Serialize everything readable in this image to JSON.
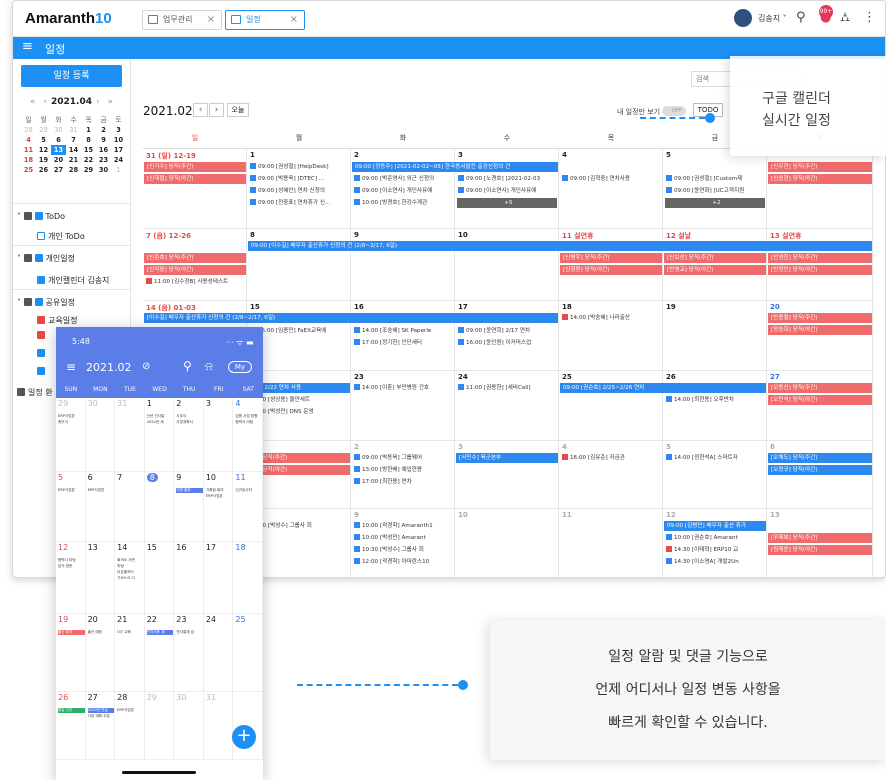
{
  "app": {
    "logo_main": "Amaranth",
    "logo_num": "10"
  },
  "tabs": [
    {
      "label": "업무관리"
    },
    {
      "label": "일정"
    }
  ],
  "user": {
    "name": "김송지"
  },
  "header": {
    "notif_count": "99+",
    "menu_title": "일정"
  },
  "sidebar": {
    "register": "일정 등록",
    "month": "2021.04",
    "weekdays": [
      "일",
      "월",
      "화",
      "수",
      "목",
      "금",
      "토"
    ],
    "weeks": [
      [
        "28",
        "29",
        "30",
        "31",
        "1",
        "2",
        "3"
      ],
      [
        "4",
        "5",
        "6",
        "7",
        "8",
        "9",
        "10"
      ],
      [
        "11",
        "12",
        "13",
        "14",
        "15",
        "16",
        "17"
      ],
      [
        "18",
        "19",
        "20",
        "21",
        "22",
        "23",
        "24"
      ],
      [
        "25",
        "26",
        "27",
        "28",
        "29",
        "30",
        "1"
      ]
    ],
    "todo_group": "ToDo",
    "todo_item": "개인 ToDo",
    "personal_group": "개인일정",
    "personal_item": "개인캘린더 김송지",
    "shared_group": "공유일정",
    "shared_item": "교육일정",
    "bottom": "일정 환"
  },
  "main": {
    "search": "검색",
    "title": "2021.02",
    "today": "오늘",
    "only_mine": "내 일정만 보기",
    "toggle": "OFF",
    "todo": "TODO",
    "weekdays": [
      "일",
      "월",
      "화",
      "수",
      "목",
      "금",
      "토"
    ]
  },
  "calendar": {
    "w1": [
      "31 (일) 12-19",
      "1",
      "2",
      "3",
      "4",
      "5",
      ""
    ],
    "w2": [
      "7 (음) 12-26",
      "8",
      "9",
      "10",
      "11 설연휴",
      "12 설날",
      "13 설연휴"
    ],
    "w3": [
      "14 (음) 01-03",
      "15",
      "16",
      "17",
      "18",
      "19",
      "20"
    ],
    "w4": [
      "",
      "",
      "23",
      "24",
      "25",
      "26",
      "27"
    ],
    "w5": [
      "",
      "",
      "2",
      "3",
      "4",
      "5",
      "6"
    ],
    "w6": [
      "",
      "",
      "9",
      "10",
      "11",
      "12",
      "13"
    ],
    "ev": {
      "a1": "[신가수] 당직(주간)",
      "a2": "[신대협] 당직(야간)",
      "a3": "09:00 [정동주] [2021-02-02~05] 한국동서발전 출장신청의 건",
      "b1": "09:00 [권성철] [HelpDesk]",
      "b2": "09:00 [박용욱] [DTEC] ...",
      "b3": "09:00 [성혜인] 연차 신청의",
      "b4": "09:00 [전중표] 연차휴가 신...",
      "c1": "09:00 [박준영사] 외근 신청의",
      "c2": "09:00 [이소연사] 개인사유에",
      "c3": "10:00 [방경호] 한강수계관",
      "d1": "09:00 [노경호] [2021-02-03",
      "d2": "09:00 [이소연사] 개인사유에",
      "d3": "+5",
      "e1": "09:00 [김혁중] 연차사용",
      "f1": "09:00 [권성철] [Custom제",
      "f2": "09:00 [윤연화] [UC고객지원",
      "f3": "+2",
      "g1": "[신우현] 당직(주간)",
      "g2": "[신승현] 당직(야간)",
      "h1": "[신준호] 당직(주간)",
      "h2": "[신미웅] 당직(야간)",
      "h3": "11:00 [김수정B] 사용성테스트",
      "h4": "09:00 [이수길] 배우자 출산휴가 신청의 건 (2/8~2/17, 6일)",
      "i1": "[신병우] 당직(주간)",
      "i2": "[신형환] 당직(야간)",
      "i3": "[신보성] 당직(주간)",
      "i4": "[안영교] 당직(야간)",
      "i5": "[안영진] 당직(주간)",
      "i6": "[안정인] 당직(야간)",
      "j1": "[이수길] 배우자 출산휴가 신청의 건 (2/8~2/17, 6일)",
      "j2": "14:00 [박숭혜] 나라출산",
      "j3": "15:00 [임종민] FaEX교육에",
      "j4": "14:00 [조숭혜] SK Paperle",
      "j5": "17:00 [정기헌] 인단세터",
      "j6": "09:00 [윤연희] 2/17 연차",
      "j7": "16:00 [윤인원] 이커머스업",
      "j8": "[안종철] 당직(주간)",
      "j9": "[양승희] 당직(야간)",
      "k1": "[양]] 2/22 연차 사용",
      "k2": "14:00 [이훈] 부민병원 건호",
      "k3": "11:00 [권용한] [세비Cell]",
      "k4": "09:00 [권순호] 2/25~2/26 연차",
      "k5": "14:00 [최현용] 오후반차",
      "k6": "[오동신] 당직(주간)",
      "k7": "[오민석] 당직(야간)",
      "k8": "09:00 [성상용] 울만세트",
      "k9": "09:00 [박성민] DNS 운영",
      "l1": "[인] 당직(주간)",
      "l2": "[인] 당직(야간)",
      "l3": "09:00 [박동욱] 그룹웨어",
      "l4": "13:00 [방한배] 예입현용",
      "l5": "17:00 [최한용] 연차",
      "l6": "[서민수] 육군본부",
      "l7": "16:00 [김유준] 자금관",
      "l8": "14:00 [정현석A] 스마트자",
      "l9": "[오채도] 당직(주간)",
      "l10": "[오정규] 당직(야간)",
      "m1": "10:30 [박성수] 그룹사 회",
      "m2": "10:00 [곽경학] Amaranth1",
      "m3": "10:00 [박성민] Amarant",
      "m4": "10:30 [박성수] 그룹사 회",
      "m5": "12:00 [곽경학] 아마란스10",
      "m6": "09:00 [김병민] 배우자 출산 휴가",
      "m7": "10:00 [권순호] Amarant",
      "m8": "14:30 [이태혁] ERP10 교",
      "m9": "14:30 [이소영A] 개발2Un",
      "m10": "[우제복] 당직(주간)",
      "m11": "[원재윤] 당직(야간)"
    }
  },
  "tip1": {
    "line1": "구글 캘린더",
    "line2": "실시간 일정"
  },
  "tip2": {
    "line1": "일정 알람 및 댓글 기능으로",
    "line2": "언제 어디서나 일정 변동 사항을",
    "line3": "빠르게 확인할 수 있습니다."
  },
  "phone": {
    "time": "5:48",
    "status": "··· ᯤ ▬",
    "month": "2021.02",
    "my": "My",
    "weekdays": [
      "SUN",
      "MON",
      "TUE",
      "WED",
      "THU",
      "FRI",
      "SAT"
    ],
    "rows": [
      [
        "29",
        "30",
        "31",
        "1",
        "2",
        "3",
        "4"
      ],
      [
        "5",
        "6",
        "7",
        "8",
        "9",
        "10",
        "11"
      ],
      [
        "12",
        "13",
        "14",
        "15",
        "16",
        "17",
        "18"
      ],
      [
        "19",
        "20",
        "21",
        "22",
        "23",
        "24",
        "25"
      ],
      [
        "26",
        "27",
        "28",
        "29",
        "30",
        "31",
        ""
      ]
    ],
    "pe": {
      "p1": "ERP사업본",
      "p2": "총무식",
      "p3": "신년 인사말",
      "p4": "2020년 세",
      "p5": "사무식",
      "p6": "사업계획서",
      "p7": "임원 사업 방향",
      "p8": "협력사 미팅",
      "p9": "ERP사업본",
      "p10": "ERP사업본",
      "p11": "지원 출장",
      "p12": "기획팀 회의",
      "p13": "ERP사업본",
      "p14": "신규입사자",
      "p15": "협력사 미팅",
      "p16": "분석 방문",
      "p17": "회의소 서면",
      "p18": "미팅",
      "p19": "더존홀지터",
      "p20": "기브스크 디",
      "p21": "출산 휴가",
      "p22": "출산 예정",
      "p23": "OJT 교육",
      "p24": "연차사용 계",
      "p25": "전자결재 검",
      "p26": "휴일 근무",
      "p27": "2020년 연말",
      "p28": "사장 계획 수립",
      "p29": "ERP사업본"
    }
  }
}
